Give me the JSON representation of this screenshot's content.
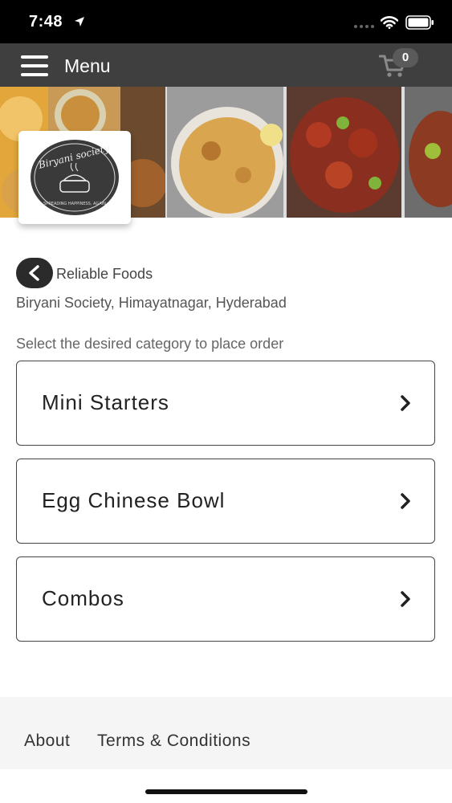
{
  "status_bar": {
    "time": "7:48"
  },
  "nav": {
    "title": "Menu",
    "cart_count": "0"
  },
  "banner": {
    "logo_text": "Biryani Society",
    "logo_tagline": "SPREADING HAPPINESS, AGAIN"
  },
  "vendor": {
    "name": "Reliable Foods",
    "outlet": "Biryani Society, Himayatnagar, Hyderabad",
    "instruction": "Select the desired category to place order"
  },
  "categories": [
    {
      "label": "Mini Starters"
    },
    {
      "label": "Egg Chinese Bowl"
    },
    {
      "label": "Combos"
    }
  ],
  "footer": {
    "about": "About",
    "terms": "Terms & Conditions"
  },
  "colors": {
    "nav_bg": "#3f3f3f",
    "status_bg": "#000000",
    "footer_bg": "#f5f5f5",
    "back_btn": "#2b2b2b"
  }
}
